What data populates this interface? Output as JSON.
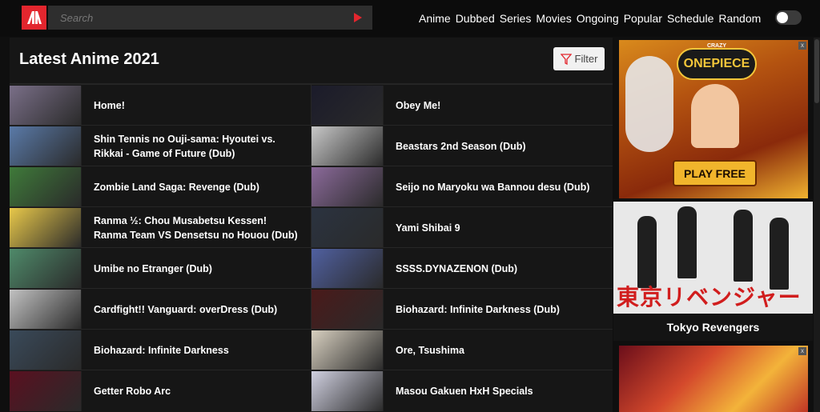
{
  "header": {
    "search_placeholder": "Search",
    "nav": [
      "Anime",
      "Dubbed",
      "Series",
      "Movies",
      "Ongoing",
      "Popular",
      "Schedule",
      "Random"
    ],
    "theme_toggle": "off"
  },
  "main": {
    "title": "Latest Anime 2021",
    "filter_label": "Filter",
    "items": [
      {
        "left": "Home!",
        "right": "Obey Me!"
      },
      {
        "left": "Shin Tennis no Ouji-sama: Hyoutei vs. Rikkai - Game of Future (Dub)",
        "right": "Beastars 2nd Season (Dub)"
      },
      {
        "left": "Zombie Land Saga: Revenge (Dub)",
        "right": "Seijo no Maryoku wa Bannou desu (Dub)"
      },
      {
        "left": "Ranma ½: Chou Musabetsu Kessen! Ranma Team VS Densetsu no Houou (Dub)",
        "right": "Yami Shibai 9"
      },
      {
        "left": "Umibe no Etranger (Dub)",
        "right": "SSSS.DYNAZENON (Dub)"
      },
      {
        "left": "Cardfight!! Vanguard: overDress (Dub)",
        "right": "Biohazard: Infinite Darkness (Dub)"
      },
      {
        "left": "Biohazard: Infinite Darkness",
        "right": "Ore, Tsushima"
      },
      {
        "left": "Getter Robo Arc",
        "right": "Masou Gakuen HxH Specials"
      }
    ]
  },
  "sidebar": {
    "ad1": {
      "brand_small": "CRAZY",
      "brand": "ONEPIECE",
      "cta": "PLAY FREE"
    },
    "feature": {
      "title": "Tokyo Revengers",
      "logo_text": "東京リベンジャーズ"
    },
    "ad_close": "x"
  },
  "colors": {
    "accent": "#e3262e",
    "background": "#0f0f0f",
    "panel": "#161616"
  }
}
